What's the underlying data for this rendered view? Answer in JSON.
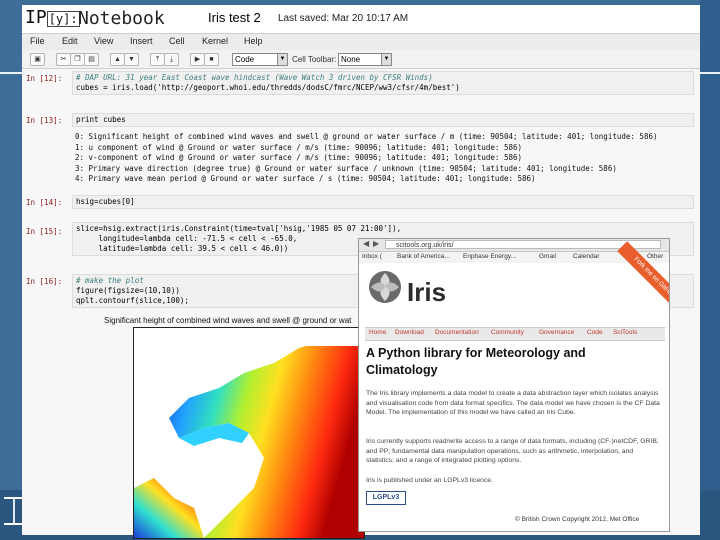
{
  "colors": {
    "slide_bg": "#3d6e99",
    "iris_orange": "#e85f2d",
    "prompt_red": "#8b1a1a"
  },
  "app": {
    "logo": "IP",
    "logo_badge": "[y]:",
    "notebook_word": "Notebook",
    "title": "Iris test 2",
    "last_saved": "Last saved: Mar 20 10:17 AM"
  },
  "menu": [
    "File",
    "Edit",
    "View",
    "Insert",
    "Cell",
    "Kernel",
    "Help"
  ],
  "toolbar": {
    "cell_type": "Code",
    "cell_toolbar_label": "Cell Toolbar:",
    "cell_toolbar_value": "None"
  },
  "cells": [
    {
      "prompt": "In [12]:",
      "line1": "# DAP URL: 31 year East Coast wave hindcast (Wave Watch 3 driven by CFSR Winds)",
      "line2": "cubes = iris.load('http://geoport.whoi.edu/thredds/dodsC/fmrc/NCEP/ww3/cfsr/4m/best')"
    },
    {
      "prompt": "In [13]:",
      "code": "print cubes",
      "output": [
        "0: Significant height of combined wind waves and swell @ ground or water surface / m (time: 90504; latitude: 401; longitude: 586)",
        "1: u component of wind @ Ground or water surface / m/s (time: 90096; latitude: 401; longitude: 586)",
        "2: v-component of wind @ Ground or water surface / m/s (time: 90096; latitude: 401; longitude: 586)",
        "3: Primary wave direction (degree true) @ Ground or water surface / unknown (time: 90504; latitude: 401; longitude: 586)",
        "4: Primary wave mean period @ Ground or water surface / s (time: 90504; latitude: 401; longitude: 586)"
      ]
    },
    {
      "prompt": "In [14]:",
      "code": "hsig=cubes[0]"
    },
    {
      "prompt": "In [15]:",
      "line1": "slice=hsig.extract(iris.Constraint(time=tval['hsig,'1985 05 07 21:00']),",
      "line2": "     longitude=lambda cell: -71.5 < cell < -65.0,",
      "line3": "     latitude=lambda cell: 39.5 < cell < 46.0))"
    },
    {
      "prompt": "In [16]:",
      "line1": "# make the plot",
      "line2": "figure(figsize=(10,10))",
      "line3": "qplt.contourf(slice,100);"
    }
  ],
  "figure_title": "Significant height of combined wind waves and swell @ ground or wat",
  "browser": {
    "url": "scitools.org.uk/iris/",
    "bookmarks": [
      "Inbox (",
      "Bank of America...",
      "Enphase Energy...",
      "Gmail",
      "Calendar",
      "Other"
    ],
    "site_name": "Iris",
    "ribbon": "Fork me on GitHub",
    "nav": [
      "Home",
      "Download",
      "Documentation",
      "Community",
      "Governance",
      "Code",
      "SciTools"
    ],
    "heading": "A Python library for Meteorology and Climatology",
    "para1": "The Iris library implements a data model to create a data abstraction layer which isolates analysis and visualisation code from data format specifics. The data model we have chosen is the CF Data Model. The implementation of this model we have called an Iris Cube.",
    "para2": "Iris currently supports read/write access to a range of data formats, including (CF-)netCDF, GRIB, and PP; fundamental data manipulation operations, such as arithmetic, interpolation, and statistics; and a range of integrated plotting options.",
    "para3": "Iris is published under an LGPLv3 licence.",
    "lgpl": "LGPLv3",
    "copyright": "© British Crown Copyright 2012, Met Office"
  }
}
